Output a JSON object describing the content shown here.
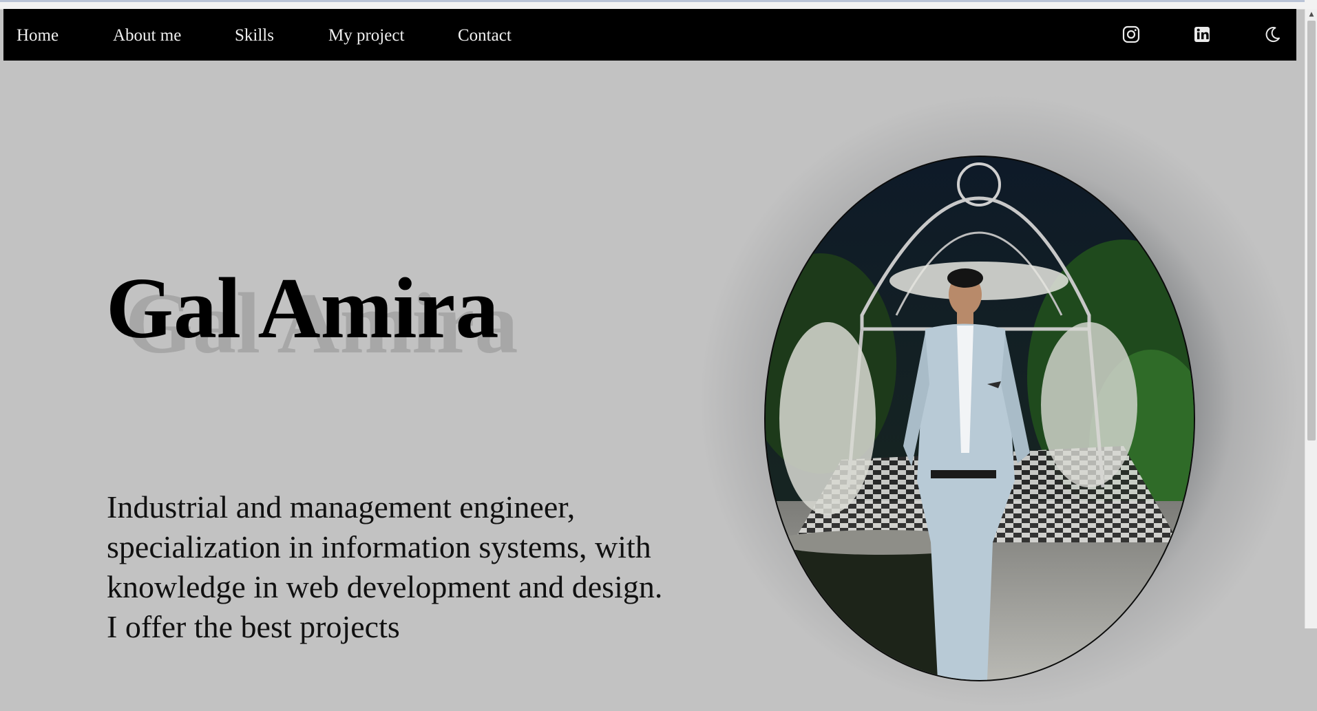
{
  "nav": {
    "links": [
      "Home",
      "About me",
      "Skills",
      "My project",
      "Contact"
    ],
    "icons": [
      "instagram-icon",
      "linkedin-icon",
      "moon-icon"
    ]
  },
  "hero": {
    "name": "Gal Amira",
    "bio": "Industrial and management engineer, specialization in information systems, with knowledge in web development and design. I offer the best projects"
  },
  "colors": {
    "background": "#c2c2c2",
    "navbar": "#000000",
    "nav_text": "#f0f0f0",
    "name_shadow": "#a7a7a7"
  }
}
